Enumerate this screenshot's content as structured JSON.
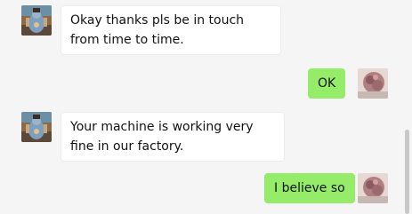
{
  "messages": [
    {
      "side": "in",
      "text": "Okay thanks pls be in touch from time to time."
    },
    {
      "side": "out",
      "text": "OK"
    },
    {
      "side": "in",
      "text": "Your machine is working very fine in our factory."
    },
    {
      "side": "out",
      "text": "I believe so"
    }
  ],
  "colors": {
    "background": "#f5f5f5",
    "incoming_bubble": "#ffffff",
    "outgoing_bubble": "#95ec69",
    "text": "#111111"
  },
  "icons": {
    "contact_avatar": "deity-avatar-icon",
    "user_avatar": "user-avatar-icon"
  }
}
